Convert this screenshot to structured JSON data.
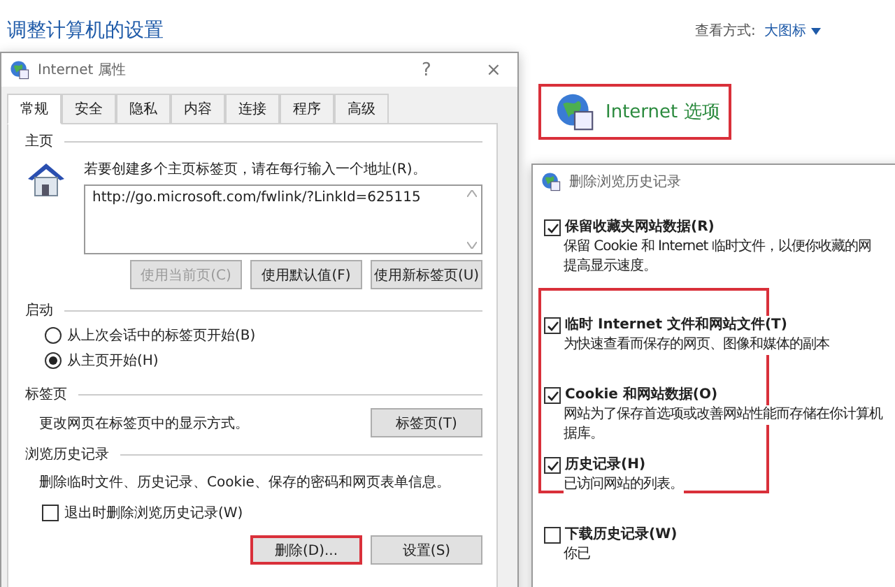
{
  "page_title": "调整计算机的设置",
  "view_by": {
    "label": "查看方式:",
    "value": "大图标"
  },
  "control_item": {
    "label": "Internet 选项",
    "highlighted": true
  },
  "properties_dialog": {
    "title": "Internet 属性",
    "help": "?",
    "close": "×",
    "tabs": [
      {
        "label": "常规",
        "selected": true
      },
      {
        "label": "安全",
        "selected": false
      },
      {
        "label": "隐私",
        "selected": false
      },
      {
        "label": "内容",
        "selected": false
      },
      {
        "label": "连接",
        "selected": false
      },
      {
        "label": "程序",
        "selected": false
      },
      {
        "label": "高级",
        "selected": false
      }
    ],
    "home": {
      "heading": "主页",
      "instruction": "若要创建多个主页标签页，请在每行输入一个地址(R)。",
      "value": "http://go.microsoft.com/fwlink/?LinkId=625115",
      "buttons": [
        {
          "label": "使用当前页(C)",
          "disabled": true
        },
        {
          "label": "使用默认值(F)",
          "disabled": false
        },
        {
          "label": "使用新标签页(U)",
          "disabled": false
        }
      ]
    },
    "startup": {
      "heading": "启动",
      "options": [
        {
          "label": "从上次会话中的标签页开始(B)",
          "selected": false
        },
        {
          "label": "从主页开始(H)",
          "selected": true
        }
      ]
    },
    "tabs_section": {
      "heading": "标签页",
      "text": "更改网页在标签页中的显示方式。",
      "button": "标签页(T)"
    },
    "history": {
      "heading": "浏览历史记录",
      "text": "删除临时文件、历史记录、Cookie、保存的密码和网页表单信息。",
      "checkbox": {
        "label": "退出时删除浏览历史记录(W)",
        "checked": false
      },
      "buttons": [
        {
          "label": "删除(D)...",
          "highlighted": true
        },
        {
          "label": "设置(S)",
          "highlighted": false
        }
      ]
    }
  },
  "delete_dialog": {
    "title": "删除浏览历史记录",
    "options": [
      {
        "label": "保留收藏夹网站数据(R)",
        "checked": true,
        "highlighted": false,
        "description_lines": [
          "保留 Cookie 和 Internet 临时文件，以便你收藏的网",
          "提高显示速度。"
        ]
      },
      {
        "label": "临时 Internet 文件和网站文件(T)",
        "checked": true,
        "highlighted": true,
        "description_lines": [
          "为快速查看而保存的网页、图像和媒体的副本"
        ]
      },
      {
        "label": "Cookie 和网站数据(O)",
        "checked": true,
        "highlighted": true,
        "description_lines": [
          "网站为了保存首选项或改善网站性能而存储在你计算机",
          "据库。"
        ]
      },
      {
        "label": "历史记录(H)",
        "checked": true,
        "highlighted": true,
        "description_lines": [
          "已访问网站的列表。"
        ]
      },
      {
        "label": "下载历史记录(W)",
        "checked": false,
        "highlighted": false,
        "description_lines": [
          "你已"
        ]
      }
    ]
  }
}
